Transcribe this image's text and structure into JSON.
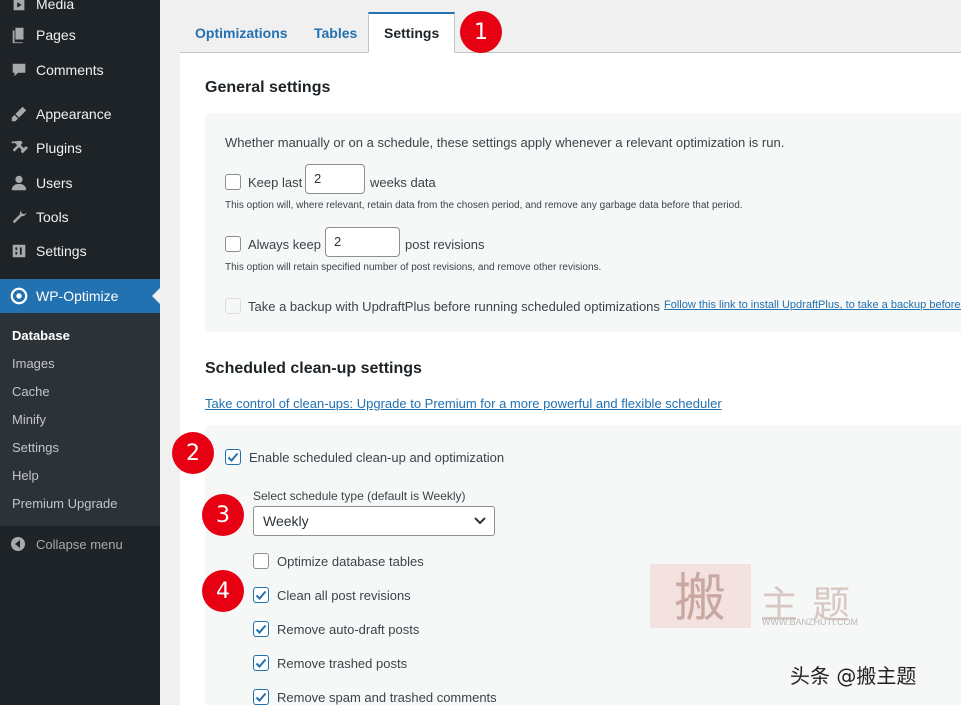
{
  "sidebar": {
    "items": [
      {
        "label": "Media",
        "icon": "media-icon"
      },
      {
        "label": "Pages",
        "icon": "pages-icon"
      },
      {
        "label": "Comments",
        "icon": "comments-icon"
      },
      {
        "label": "Appearance",
        "icon": "appearance-icon"
      },
      {
        "label": "Plugins",
        "icon": "plugins-icon"
      },
      {
        "label": "Users",
        "icon": "users-icon"
      },
      {
        "label": "Tools",
        "icon": "tools-icon"
      },
      {
        "label": "Settings",
        "icon": "settings-icon"
      },
      {
        "label": "WP-Optimize",
        "icon": "wp-optimize-icon",
        "active": true
      }
    ],
    "submenu": [
      "Database",
      "Images",
      "Cache",
      "Minify",
      "Settings",
      "Help",
      "Premium Upgrade"
    ],
    "collapse_label": "Collapse menu"
  },
  "tabs": [
    {
      "label": "Optimizations"
    },
    {
      "label": "Tables"
    },
    {
      "label": "Settings",
      "active": true
    }
  ],
  "general": {
    "heading": "General settings",
    "intro": "Whether manually or on a schedule, these settings apply whenever a relevant optimization is run.",
    "keep_last_label": "Keep last",
    "keep_last_value": "2",
    "keep_last_unit": "weeks data",
    "keep_last_help": "This option will, where relevant, retain data from the chosen period, and remove any garbage data before that period.",
    "always_keep_label": "Always keep",
    "always_keep_value": "2",
    "always_keep_unit": "post revisions",
    "always_keep_help": "This option will retain specified number of post revisions, and remove other revisions.",
    "backup_label": "Take a backup with UpdraftPlus before running scheduled optimizations",
    "backup_link": "Follow this link to install UpdraftPlus, to take a backup before c"
  },
  "scheduled": {
    "heading": "Scheduled clean-up settings",
    "premium_link": "Take control of clean-ups: Upgrade to Premium for a more powerful and flexible scheduler",
    "enable_label": "Enable scheduled clean-up and optimization",
    "enable_checked": true,
    "schedule_type_label": "Select schedule type (default is Weekly)",
    "schedule_type_value": "Weekly",
    "options": [
      {
        "label": "Optimize database tables",
        "checked": false
      },
      {
        "label": "Clean all post revisions",
        "checked": true
      },
      {
        "label": "Remove auto-draft posts",
        "checked": true
      },
      {
        "label": "Remove trashed posts",
        "checked": true
      },
      {
        "label": "Remove spam and trashed comments",
        "checked": true
      }
    ]
  },
  "badges": [
    "1",
    "2",
    "3",
    "4"
  ],
  "watermark": {
    "title": "主题",
    "url": "WWW.BANZHUTI.COM",
    "credit": "头条 @搬主题"
  },
  "colors": {
    "sidebar_bg": "#1d2327",
    "accent": "#2271b1",
    "badge": "#e60012"
  }
}
